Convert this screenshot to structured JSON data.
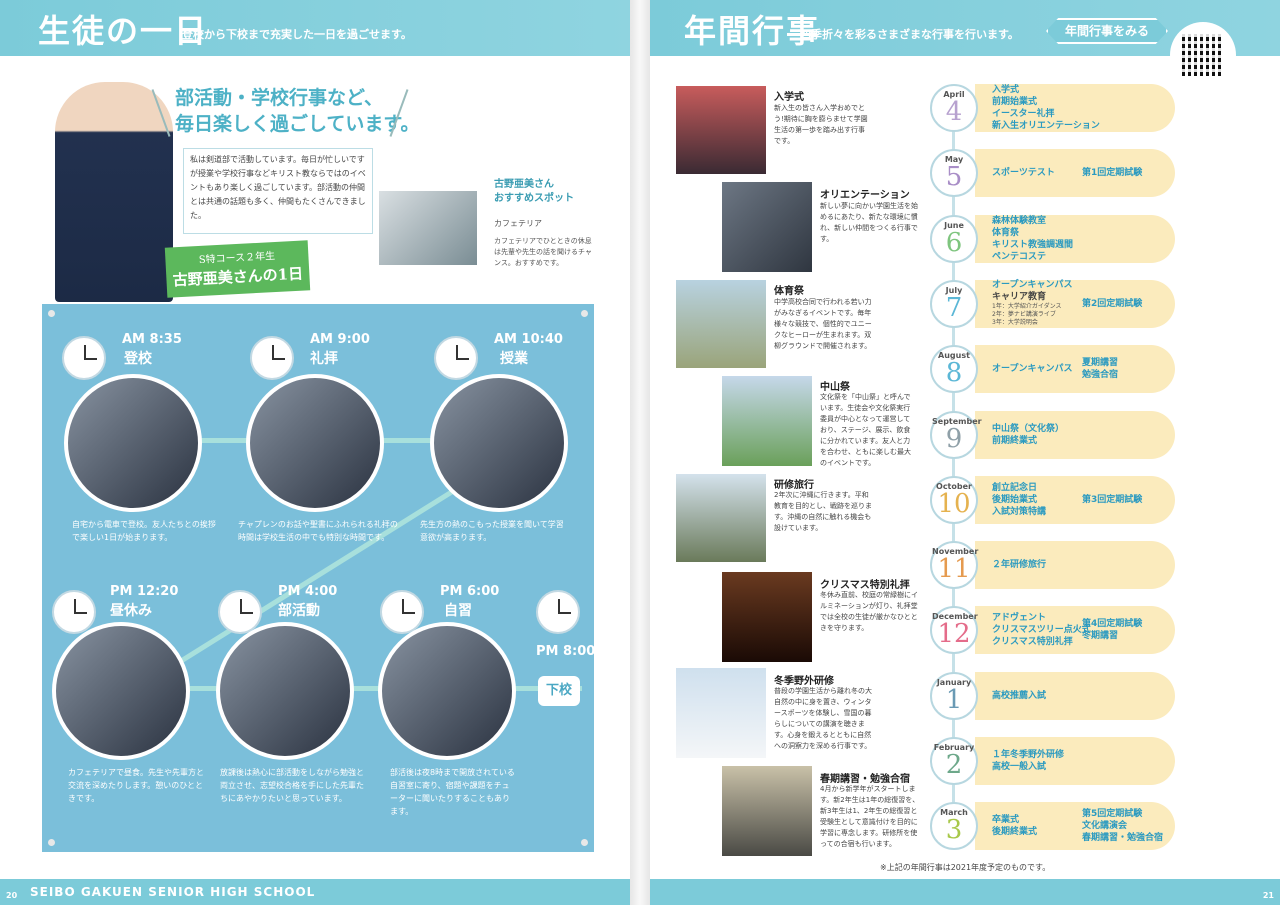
{
  "left": {
    "title": "生徒の一日",
    "subtitle": "登校から下校まで充実した一日を過ごせます。",
    "headline_1": "部活動・学校行事など、",
    "headline_2": "毎日楽しく過ごしています。",
    "intro": "私は剣道部で活動しています。毎日が忙しいですが授業や学校行事などキリスト教ならではのイベントもあり楽しく過ごしています。部活動の仲間とは共通の話題も多く、仲間もたくさんできました。",
    "course": "S特コース２年生",
    "student_day": "古野亜美さんの1日",
    "spot_line1": "古野亜美さん",
    "spot_line2": "おすすめスポット",
    "spot_name": "カフェテリア",
    "spot_body": "カフェテリアでひとときの休息は先輩や先生の話を聞けるチャンス。おすすめです。",
    "schedule": [
      {
        "time": "AM 8:35",
        "activity": "登校",
        "desc": "自宅から電車で登校。友人たちとの挨拶で楽しい1日が始まります。"
      },
      {
        "time": "AM 9:00",
        "activity": "礼拝",
        "desc": "チャプレンのお話や聖書にふれられる礼拝の時間は学校生活の中でも特別な時間です。"
      },
      {
        "time": "AM 10:40",
        "activity": "授業",
        "desc": "先生方の熱のこもった授業を聞いて学習意欲が高まります。"
      },
      {
        "time": "PM 12:20",
        "activity": "昼休み",
        "desc": "カフェテリアで昼食。先生や先輩方と交流を深めたりします。憩いのひとときです。"
      },
      {
        "time": "PM 4:00",
        "activity": "部活動",
        "desc": "放課後は熱心に部活動をしながら勉強と両立させ、志望校合格を手にした先輩たちにあやかりたいと思っています。"
      },
      {
        "time": "PM 6:00",
        "activity": "自習",
        "desc": "部活後は夜8時まで開放されている自習室に寄り、宿題や課題をチューターに聞いたりすることもあります。"
      }
    ],
    "end_time": "PM 8:00",
    "end_label": "下校",
    "footer_school": "SEIBO GAKUEN SENIOR HIGH SCHOOL",
    "page_no": "20"
  },
  "right": {
    "title": "年間行事",
    "subtitle": "四季折々を彩るさまざまな行事を行います。",
    "button": "年間行事をみる",
    "events": [
      {
        "name": "入学式",
        "body": "新入生の皆さん入学おめでとう!期待に胸を膨らませて学園生活の第一歩を踏み出す行事です。"
      },
      {
        "name": "オリエンテーション",
        "body": "新しい夢に向かい学園生活を始めるにあたり、新たな環境に慣れ、新しい仲間をつくる行事です。"
      },
      {
        "name": "体育祭",
        "body": "中学高校合同で行われる若い力がみなぎるイベントです。毎年様々な競技で、個性的でユニークなヒーローが生まれます。双柳グラウンドで開催されます。"
      },
      {
        "name": "中山祭",
        "body": "文化祭を「中山祭」と呼んでいます。生徒会や文化祭実行委員が中心となって運営しており、ステージ、展示、飲食に分かれています。友人と力を合わせ、ともに楽しむ最大のイベントです。"
      },
      {
        "name": "研修旅行",
        "body": "2年次に沖縄に行きます。平和教育を目的とし、戦跡を巡ります。沖縄の自然に触れる機会も設けています。"
      },
      {
        "name": "クリスマス特別礼拝",
        "body": "冬休み直前、校庭の常緑樹にイルミネーションが灯り、礼拝堂では全校の生徒が厳かなひとときを守ります。"
      },
      {
        "name": "冬季野外研修",
        "body": "普段の学園生活から離れ冬の大自然の中に身を置き、ウィンタースポーツを体験し、雪国の暮らしについての講演を聴きます。心身を鍛えるとともに自然への洞察力を深める行事です。"
      },
      {
        "name": "春期講習・勉強合宿",
        "body": "4月から新学年がスタートします。新2年生は1年の総復習を、新3年生は1、2年生の総復習と受験生として意識付けを目的に学習に専念します。研修所を使っての合宿も行います。"
      }
    ],
    "months": [
      {
        "name": "April",
        "num": "4",
        "color": "#b7a1cf",
        "events": [
          "入学式",
          "前期始業式",
          "イースター礼拝",
          "新入生オリエンテーション"
        ],
        "events2": []
      },
      {
        "name": "May",
        "num": "5",
        "color": "#a98ec7",
        "events": [
          "スポーツテスト"
        ],
        "events2": [
          "第1回定期試験"
        ]
      },
      {
        "name": "June",
        "num": "6",
        "color": "#7fc57f",
        "events": [
          "森林体験教室",
          "体育祭",
          "キリスト教強調週間",
          "ペンテコステ"
        ],
        "events2": []
      },
      {
        "name": "July",
        "num": "7",
        "color": "#5bb7d6",
        "events": [
          "オープンキャンパス",
          "キャリア教育"
        ],
        "career": [
          "1年：大学紹介ガイダンス",
          "2年：夢ナビ講演ライブ",
          "3年：大学説明会"
        ],
        "events2": [
          "第2回定期試験"
        ]
      },
      {
        "name": "August",
        "num": "8",
        "color": "#5bb7d6",
        "events": [
          "オープンキャンパス"
        ],
        "events2": [
          "夏期講習",
          "勉強合宿"
        ]
      },
      {
        "name": "September",
        "num": "9",
        "color": "#8fa0a8",
        "events": [
          "中山祭（文化祭）",
          "前期終業式"
        ],
        "events2": []
      },
      {
        "name": "October",
        "num": "10",
        "color": "#e5b24f",
        "events": [
          "創立記念日",
          "後期始業式",
          "入試対策特講"
        ],
        "events2": [
          "第3回定期試験"
        ]
      },
      {
        "name": "November",
        "num": "11",
        "color": "#e59a4f",
        "events": [
          "２年研修旅行"
        ],
        "events2": []
      },
      {
        "name": "December",
        "num": "12",
        "color": "#e46c8a",
        "events": [
          "アドヴェント",
          "クリスマスツリー点火式",
          "クリスマス特別礼拝"
        ],
        "events2": [
          "第4回定期試験",
          "冬期講習"
        ]
      },
      {
        "name": "January",
        "num": "1",
        "color": "#6a9ab4",
        "events": [
          "高校推薦入試"
        ],
        "events2": []
      },
      {
        "name": "February",
        "num": "2",
        "color": "#6da88a",
        "events": [
          "１年冬季野外研修",
          "高校一般入試"
        ],
        "events2": []
      },
      {
        "name": "March",
        "num": "3",
        "color": "#a8c84a",
        "events": [
          "卒業式",
          "後期終業式"
        ],
        "events2": [
          "第5回定期試験",
          "文化講演会",
          "春期講習・勉強合宿"
        ]
      }
    ],
    "note": "※上記の年間行事は2021年度予定のものです。",
    "page_no": "21"
  },
  "colors": {
    "accent": "#7ccbd9",
    "month_text": "#2b9ac0",
    "exam_text": "#2b9ac0",
    "bar": "#fbebbd"
  }
}
